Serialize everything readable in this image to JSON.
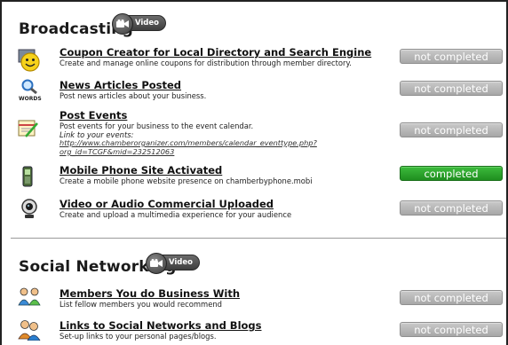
{
  "sections": [
    {
      "title": "Broadcasting",
      "video_label": "Video",
      "items": [
        {
          "icon": "smiley-coupon-icon",
          "title": "Coupon Creator for Local Directory and Search Engine",
          "description": "Create and manage online coupons for distribution through member directory.",
          "status": "not completed"
        },
        {
          "icon": "magnifier-words-icon",
          "icon_text": "WORDS",
          "title": "News Articles Posted",
          "description": "Post news articles about your business.",
          "status": "not completed"
        },
        {
          "icon": "calendar-edit-icon",
          "title": "Post Events",
          "description": "Post events for your business to the event calendar.",
          "link_label": "Link to your events:",
          "link_line1": "http://www.chamberorganizer.com/members/calendar_eventtype.php?",
          "link_line2": "org_id=TCGF&mid=232512063",
          "status": "not completed"
        },
        {
          "icon": "mobile-phone-icon",
          "title": "Mobile Phone Site Activated",
          "description": "Create a mobile phone website presence on chamberbyphone.mobi",
          "status": "completed"
        },
        {
          "icon": "webcam-icon",
          "title": "Video or Audio Commercial Uploaded",
          "description": "Create and upload a multimedia experience for your audience",
          "status": "not completed"
        }
      ]
    },
    {
      "title": "Social Networking",
      "video_label": "Video",
      "items": [
        {
          "icon": "people-network-icon",
          "title": "Members You do Business With",
          "description": "List fellow members you would recommend",
          "status": "not completed"
        },
        {
          "icon": "people-links-icon",
          "title": "Links to Social Networks and Blogs",
          "description": "Set-up links to your personal pages/blogs.",
          "status": "not completed"
        }
      ]
    }
  ],
  "colors": {
    "completed": "#2aa52a",
    "not_completed": "#b3b3b3"
  }
}
